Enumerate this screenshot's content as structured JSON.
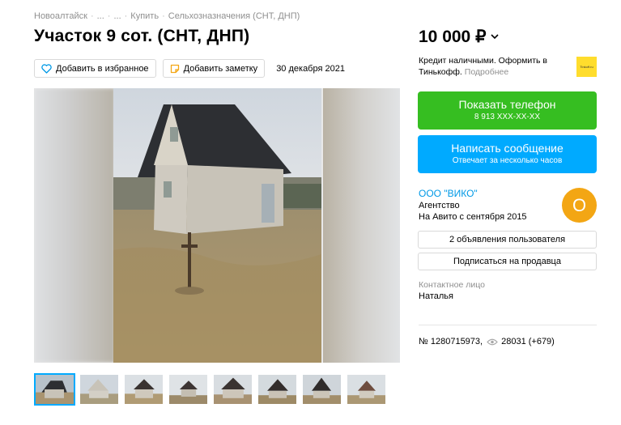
{
  "breadcrumbs": [
    "Новоалтайск",
    "...",
    "...",
    "Купить",
    "Сельхозназначения (СНТ, ДНП)"
  ],
  "title": "Участок 9 сот. (СНТ, ДНП)",
  "actions": {
    "favorite_label": "Добавить в избранное",
    "note_label": "Добавить заметку",
    "date": "30 декабря 2021"
  },
  "price": "10 000 ₽",
  "credit": {
    "text": "Кредит наличными. Оформить в Тинькофф.",
    "more": "Подробнее",
    "logo_text": "Tinkoff.ru"
  },
  "phone_button": {
    "label": "Показать телефон",
    "sub": "8 913 XXX-XX-XX"
  },
  "message_button": {
    "label": "Написать сообщение",
    "sub": "Отвечает за несколько часов"
  },
  "seller": {
    "name": "ООО \"ВИКО\"",
    "type": "Агентство",
    "since": "На Авито с сентября 2015",
    "avatar_letter": "О",
    "avatar_color": "#f3a614"
  },
  "ads_button": "2 объявления пользователя",
  "subscribe_button": "Подписаться на продавца",
  "contact": {
    "label": "Контактное лицо",
    "name": "Наталья"
  },
  "meta": {
    "number": "№ 1280715973,",
    "views": "28031 (+679)"
  },
  "colors": {
    "phone_green": "#36be21",
    "message_blue": "#00aaff",
    "link_blue": "#0099e6"
  },
  "icons": [
    "heart-icon",
    "note-icon",
    "chevron-down-icon",
    "eye-icon"
  ]
}
